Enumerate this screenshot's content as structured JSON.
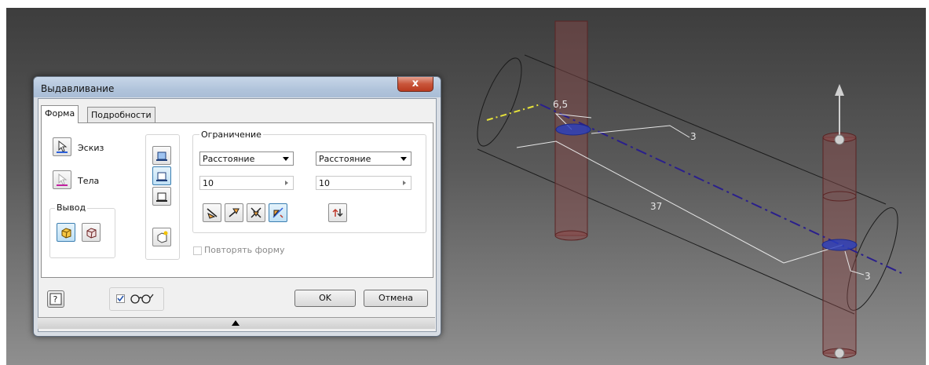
{
  "dialog": {
    "title": "Выдавливание",
    "close_glyph": "x",
    "tabs": [
      "Форма",
      "Подробности"
    ],
    "profile_label": "Эскиз",
    "solids_label": "Тела",
    "output": {
      "title": "Вывод",
      "options": [
        "solid-output-icon",
        "surface-output-icon"
      ]
    },
    "extents": {
      "title": "Ограничение",
      "direction1": {
        "type": "Расстояние",
        "value": "10"
      },
      "direction2": {
        "type": "Расстояние",
        "value": "10"
      }
    },
    "operations": [
      "join-icon",
      "cut-icon",
      "intersect-icon",
      "new-solid-icon"
    ],
    "direction_buttons": [
      "direction1-icon",
      "direction2-icon",
      "symmetric-icon",
      "asymmetric-icon",
      "flip-icon"
    ],
    "match_shape_label": "Повторять форму",
    "match_shape_checked": false,
    "preview_checked": true,
    "ok_label": "OK",
    "cancel_label": "Отмена"
  },
  "viewport": {
    "dimensions": [
      "6,5",
      "3",
      "37",
      "3"
    ],
    "colors": {
      "background_top": "#3d3d3d",
      "background_bottom": "#8f8f8f",
      "cylinder": "#8a4a4a",
      "axis": "#2a1f8c",
      "yellow_edge": "#e6e23a",
      "hole": "#2b3fbf"
    }
  }
}
